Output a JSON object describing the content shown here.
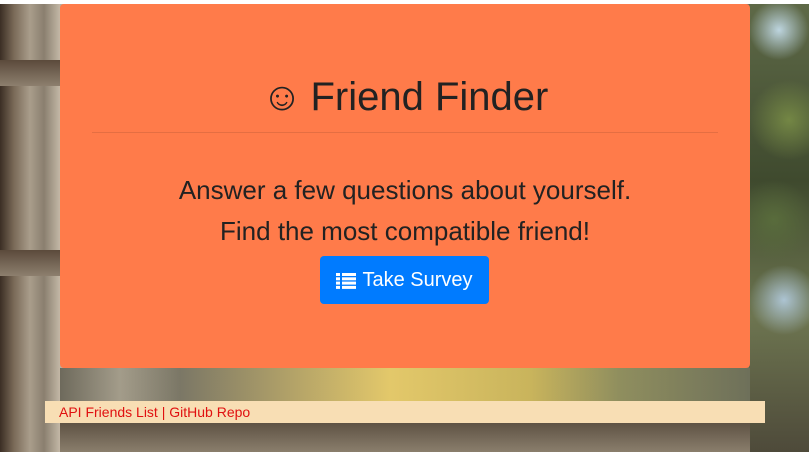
{
  "header": {
    "icon": "smile-icon",
    "icon_glyph": "☺",
    "title": "Friend Finder"
  },
  "intro": {
    "line1": "Answer a few questions about yourself.",
    "line2": "Find the most compatible friend!"
  },
  "survey_button": {
    "icon": "list-icon",
    "label": "Take Survey"
  },
  "footer": {
    "link1": "API Friends List",
    "separator": " | ",
    "link2": "GitHub Repo"
  },
  "colors": {
    "jumbotron": "#ff7b4a",
    "button": "#007bff",
    "footer_bg": "#f8deb4",
    "footer_link": "#e01010"
  }
}
